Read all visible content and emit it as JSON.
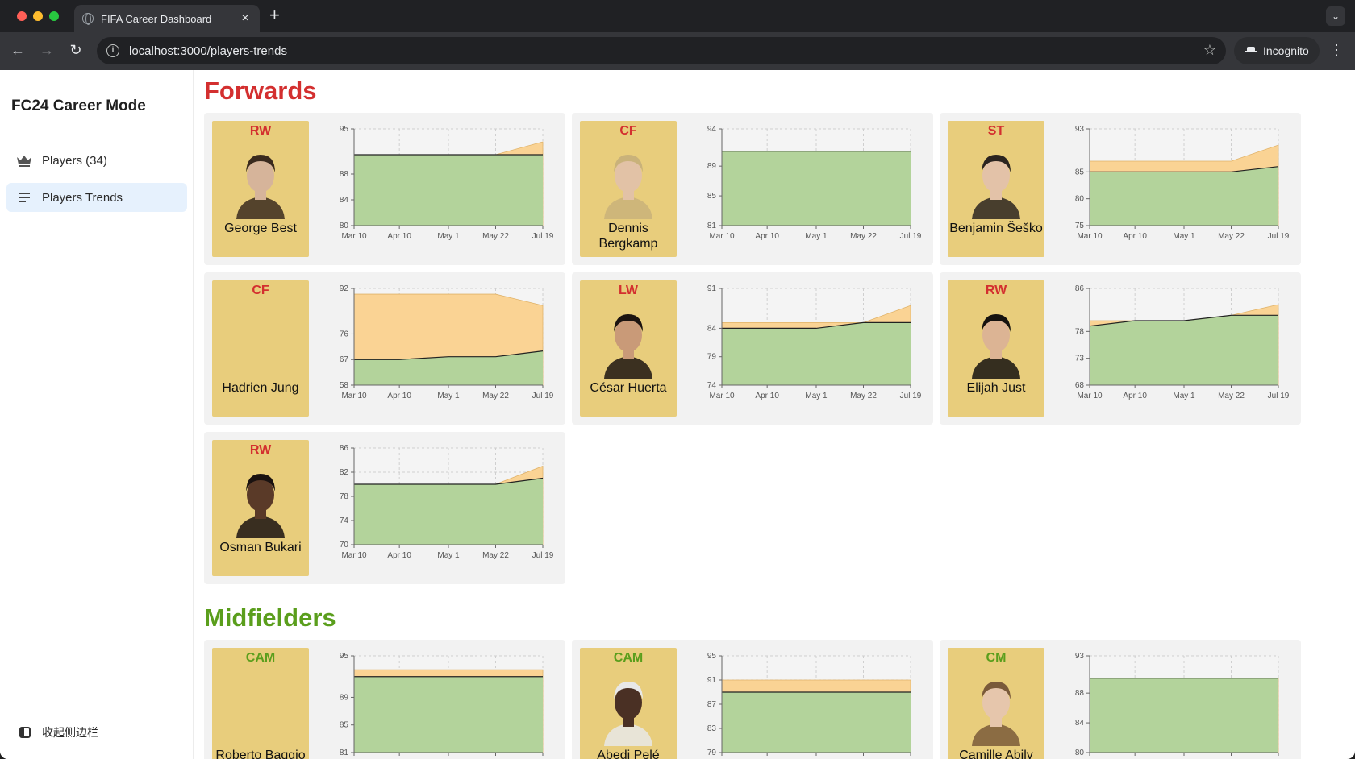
{
  "browser": {
    "tab_title": "FIFA Career Dashboard",
    "url": "localhost:3000/players-trends",
    "incognito_label": "Incognito"
  },
  "sidebar": {
    "brand": "FC24 Career Mode",
    "items": [
      {
        "label": "Players (34)",
        "icon": "crown-icon"
      },
      {
        "label": "Players Trends",
        "icon": "list-icon"
      }
    ],
    "collapse_label": "收起侧边栏"
  },
  "colors": {
    "forwards_title": "#d32f2f",
    "midfielders_title": "#5a9e1c",
    "card_gold": "#e8cd7c",
    "trend_fill_current": "#b3d39b",
    "trend_fill_potential": "#fad394"
  },
  "x_ticks": [
    "Mar 10",
    "Apr 10",
    "May 1",
    "May 22",
    "Jul 19"
  ],
  "sections": [
    {
      "title": "Forwards",
      "players": [
        {
          "name": "George Best",
          "position": "RW",
          "y_ticks": [
            "95",
            "88",
            "84",
            "80"
          ],
          "current": [
            91,
            91,
            91,
            91,
            91
          ],
          "potential": [
            91,
            91,
            91,
            91,
            93
          ]
        },
        {
          "name": "Dennis Bergkamp",
          "position": "CF",
          "y_ticks": [
            "94",
            "89",
            "85",
            "81"
          ],
          "current": [
            91,
            91,
            91,
            91,
            91
          ],
          "potential": [
            91,
            91,
            91,
            91,
            91
          ]
        },
        {
          "name": "Benjamin Šeško",
          "position": "ST",
          "y_ticks": [
            "93",
            "85",
            "80",
            "75"
          ],
          "current": [
            85,
            85,
            85,
            85,
            86
          ],
          "potential": [
            87,
            87,
            87,
            87,
            90
          ]
        },
        {
          "name": "Hadrien Jung",
          "position": "CF",
          "y_ticks": [
            "92",
            "76",
            "67",
            "58"
          ],
          "current": [
            67,
            67,
            68,
            68,
            70
          ],
          "potential": [
            90,
            90,
            90,
            90,
            86
          ]
        },
        {
          "name": "César Huerta",
          "position": "LW",
          "y_ticks": [
            "91",
            "84",
            "79",
            "74"
          ],
          "current": [
            84,
            84,
            84,
            85,
            85
          ],
          "potential": [
            85,
            85,
            85,
            85,
            88
          ]
        },
        {
          "name": "Elijah Just",
          "position": "RW",
          "y_ticks": [
            "86",
            "78",
            "73",
            "68"
          ],
          "current": [
            79,
            80,
            80,
            81,
            81
          ],
          "potential": [
            80,
            80,
            80,
            81,
            83
          ]
        },
        {
          "name": "Osman Bukari",
          "position": "RW",
          "y_ticks": [
            "86",
            "82",
            "78",
            "74",
            "70"
          ],
          "current": [
            80,
            80,
            80,
            80,
            81
          ],
          "potential": [
            80,
            80,
            80,
            80,
            83
          ]
        }
      ]
    },
    {
      "title": "Midfielders",
      "players": [
        {
          "name": "Roberto Baggio",
          "position": "CAM",
          "y_ticks": [
            "95",
            "89",
            "85",
            "81"
          ],
          "current": [
            92,
            92,
            92,
            92,
            92
          ],
          "potential": [
            93,
            93,
            93,
            93,
            93
          ]
        },
        {
          "name": "Abedi Pelé",
          "position": "CAM",
          "y_ticks": [
            "95",
            "91",
            "87",
            "83",
            "79"
          ],
          "current": [
            89,
            89,
            89,
            89,
            89
          ],
          "potential": [
            91,
            91,
            91,
            91,
            91
          ]
        },
        {
          "name": "Camille Abily",
          "position": "CM",
          "y_ticks": [
            "93",
            "88",
            "84",
            "80"
          ],
          "current": [
            90,
            90,
            90,
            90,
            90
          ],
          "potential": [
            90,
            90,
            90,
            90,
            90
          ]
        }
      ]
    }
  ]
}
